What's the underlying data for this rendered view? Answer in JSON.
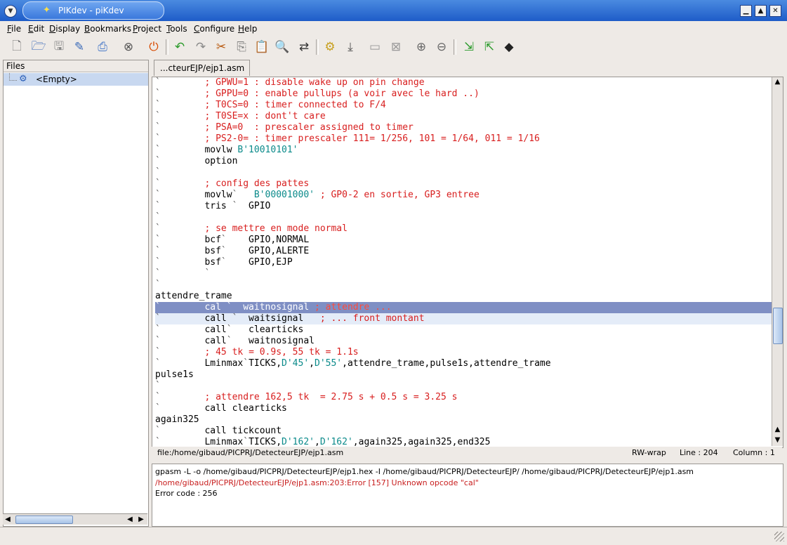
{
  "window": {
    "title": "PIKdev - piKdev",
    "controls": {
      "minimize": "▁",
      "maximize": "▲",
      "close": "✕"
    }
  },
  "menu": [
    {
      "underline": "F",
      "rest": "ile"
    },
    {
      "underline": "E",
      "rest": "dit"
    },
    {
      "underline": "D",
      "rest": "isplay"
    },
    {
      "underline": "B",
      "rest": "ookmarks"
    },
    {
      "underline": "P",
      "rest": "roject"
    },
    {
      "underline": "T",
      "rest": "ools"
    },
    {
      "underline": "C",
      "rest": "onfigure"
    },
    {
      "underline": "H",
      "rest": "elp"
    }
  ],
  "toolbar_icons": [
    "new-file",
    "open-file",
    "save-file",
    "save-as",
    "print",
    "close-file",
    "quit",
    "undo",
    "redo",
    "cut",
    "copy",
    "paste",
    "find",
    "replace",
    "compile",
    "program-device",
    "read-device",
    "display-blank",
    "erase-device",
    "add-file",
    "remove-file",
    "import",
    "export",
    "chip-settings"
  ],
  "files_panel": {
    "header": "Files",
    "item": "<Empty>"
  },
  "tab": {
    "label": "...cteurEJP/ejp1.asm"
  },
  "code_lines": [
    [
      {
        "t": "`",
        "c": "dot"
      },
      {
        "t": "        "
      },
      {
        "t": "; GPWU=1 : disable wake up on pin change",
        "c": "red"
      }
    ],
    [
      {
        "t": "`",
        "c": "dot"
      },
      {
        "t": "        "
      },
      {
        "t": "; GPPU=0 : enable pullups (a voir avec le hard ..)",
        "c": "red"
      }
    ],
    [
      {
        "t": "`",
        "c": "dot"
      },
      {
        "t": "        "
      },
      {
        "t": "; T0CS=0 : timer connected to F/4",
        "c": "red"
      }
    ],
    [
      {
        "t": "`",
        "c": "dot"
      },
      {
        "t": "        "
      },
      {
        "t": "; T0SE=x : dont't care",
        "c": "red"
      }
    ],
    [
      {
        "t": "`",
        "c": "dot"
      },
      {
        "t": "        "
      },
      {
        "t": "; PSA=0  : prescaler assigned to timer",
        "c": "red"
      }
    ],
    [
      {
        "t": "`",
        "c": "dot"
      },
      {
        "t": "        "
      },
      {
        "t": "; PS2-0= : timer prescaler 111= 1/256, 101 = 1/64, 011 = 1/16",
        "c": "red"
      }
    ],
    [
      {
        "t": "`",
        "c": "dot"
      },
      {
        "t": "        movlw "
      },
      {
        "t": "B'10010101'",
        "c": "teal"
      }
    ],
    [
      {
        "t": "`",
        "c": "dot"
      },
      {
        "t": "        option"
      }
    ],
    [
      {
        "t": "`",
        "c": "dot"
      }
    ],
    [
      {
        "t": "`",
        "c": "dot"
      },
      {
        "t": "        "
      },
      {
        "t": "; config des pattes",
        "c": "red"
      }
    ],
    [
      {
        "t": "`",
        "c": "dot"
      },
      {
        "t": "        movlw"
      },
      {
        "t": "`",
        "c": "dot"
      },
      {
        "t": "   "
      },
      {
        "t": "B'00001000'",
        "c": "teal"
      },
      {
        "t": " "
      },
      {
        "t": "; GP0-2 en sortie, GP3 entree",
        "c": "red"
      }
    ],
    [
      {
        "t": "`",
        "c": "dot"
      },
      {
        "t": "        tris "
      },
      {
        "t": "`",
        "c": "dot"
      },
      {
        "t": "  GPIO"
      }
    ],
    [
      {
        "t": "`",
        "c": "dot"
      }
    ],
    [
      {
        "t": "`",
        "c": "dot"
      },
      {
        "t": "        "
      },
      {
        "t": "; se mettre en mode normal",
        "c": "red"
      }
    ],
    [
      {
        "t": "`",
        "c": "dot"
      },
      {
        "t": "        bcf"
      },
      {
        "t": "`",
        "c": "dot"
      },
      {
        "t": "    GPIO,NORMAL"
      }
    ],
    [
      {
        "t": "`",
        "c": "dot"
      },
      {
        "t": "        bsf"
      },
      {
        "t": "`",
        "c": "dot"
      },
      {
        "t": "    GPIO,ALERTE"
      }
    ],
    [
      {
        "t": "`",
        "c": "dot"
      },
      {
        "t": "        bsf"
      },
      {
        "t": "`",
        "c": "dot"
      },
      {
        "t": "    GPIO,EJP"
      }
    ],
    [
      {
        "t": "`",
        "c": "dot"
      },
      {
        "t": "        "
      },
      {
        "t": "`",
        "c": "dot"
      }
    ],
    [
      {
        "t": "`",
        "c": "dot"
      }
    ],
    [
      {
        "t": "attendre_trame"
      }
    ],
    [
      {
        "t": "`",
        "c": "dot"
      },
      {
        "t": "        cal "
      },
      {
        "t": "`",
        "c": "dot"
      },
      {
        "t": "  waitnosignal "
      },
      {
        "t": "; attendre ...",
        "c": "red"
      }
    ],
    [
      {
        "t": "`",
        "c": "dot"
      },
      {
        "t": "        call "
      },
      {
        "t": "`",
        "c": "dot"
      },
      {
        "t": "  waitsignal   "
      },
      {
        "t": "; ... front montant",
        "c": "red"
      }
    ],
    [
      {
        "t": "`",
        "c": "dot"
      },
      {
        "t": "        call"
      },
      {
        "t": "`",
        "c": "dot"
      },
      {
        "t": "   clearticks"
      }
    ],
    [
      {
        "t": "`",
        "c": "dot"
      },
      {
        "t": "        call"
      },
      {
        "t": "`",
        "c": "dot"
      },
      {
        "t": "   waitnosignal"
      }
    ],
    [
      {
        "t": "`",
        "c": "dot"
      },
      {
        "t": "        "
      },
      {
        "t": "; 45 tk = 0.9s, 55 tk = 1.1s",
        "c": "red"
      }
    ],
    [
      {
        "t": "`",
        "c": "dot"
      },
      {
        "t": "        Lminmax"
      },
      {
        "t": "`",
        "c": "dot"
      },
      {
        "t": "TICKS,"
      },
      {
        "t": "D'45'",
        "c": "teal"
      },
      {
        "t": ","
      },
      {
        "t": "D'55'",
        "c": "teal"
      },
      {
        "t": ",attendre_trame,pulse1s,attendre_trame"
      }
    ],
    [
      {
        "t": "pulse1s"
      }
    ],
    [
      {
        "t": "`",
        "c": "dot"
      }
    ],
    [
      {
        "t": "`",
        "c": "dot"
      },
      {
        "t": "        "
      },
      {
        "t": "; attendre 162,5 tk  = 2.75 s + 0.5 s = 3.25 s",
        "c": "red"
      }
    ],
    [
      {
        "t": "`",
        "c": "dot"
      },
      {
        "t": "        call clearticks"
      }
    ],
    [
      {
        "t": "again325"
      }
    ],
    [
      {
        "t": "`",
        "c": "dot"
      },
      {
        "t": "        call tickcount"
      }
    ],
    [
      {
        "t": "`",
        "c": "dot"
      },
      {
        "t": "        Lminmax"
      },
      {
        "t": "`",
        "c": "dot"
      },
      {
        "t": "TICKS,"
      },
      {
        "t": "D'162'",
        "c": "teal"
      },
      {
        "t": ","
      },
      {
        "t": "D'162'",
        "c": "teal"
      },
      {
        "t": ",again325,again325,end325"
      }
    ]
  ],
  "highlighted_line_index": 20,
  "secondary_highlight_index": 21,
  "status": {
    "file": "file:/home/gibaud/PICPRJ/DetecteurEJP/ejp1.asm",
    "mode": "RW-wrap",
    "line": "Line :  204",
    "column": "Column :  1"
  },
  "output": {
    "command": "gpasm -L -o /home/gibaud/PICPRJ/DetecteurEJP/ejp1.hex -I /home/gibaud/PICPRJ/DetecteurEJP/ /home/gibaud/PICPRJ/DetecteurEJP/ejp1.asm",
    "error": "/home/gibaud/PICPRJ/DetecteurEJP/ejp1.asm:203:Error [157] Unknown opcode \"cal\"",
    "code": "Error code : 256"
  },
  "colors": {
    "comment": "#d81e1e",
    "literal": "#0a8a8a",
    "selection": "#7f8fc4"
  }
}
